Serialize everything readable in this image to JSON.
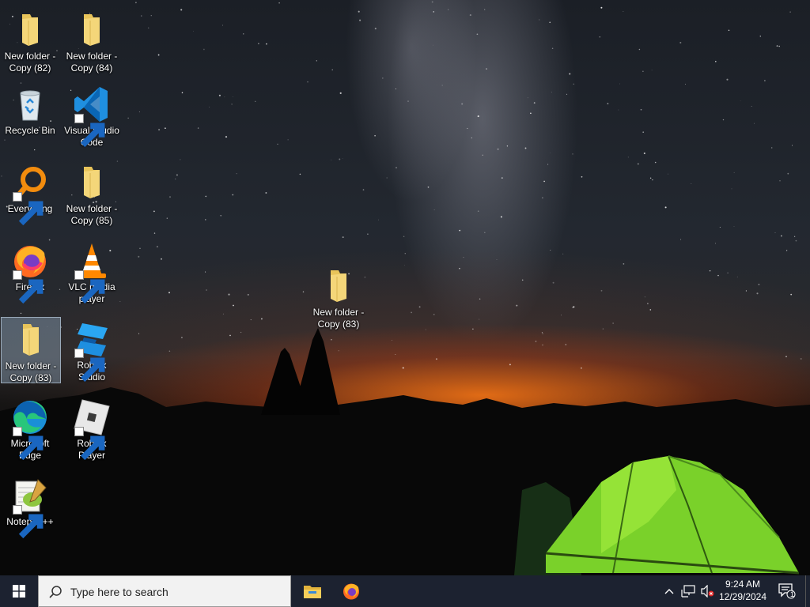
{
  "desktop": {
    "icons": [
      {
        "label": "New folder - Copy (82)",
        "type": "folder"
      },
      {
        "label": "New folder - Copy (84)",
        "type": "folder"
      },
      {
        "label": "Recycle Bin",
        "type": "recycle-bin"
      },
      {
        "label": "Visual Studio Code",
        "type": "vscode",
        "shortcut": true
      },
      {
        "label": "Everything",
        "type": "everything",
        "shortcut": true
      },
      {
        "label": "New folder - Copy (85)",
        "type": "folder"
      },
      {
        "label": "Firefox",
        "type": "firefox",
        "shortcut": true
      },
      {
        "label": "VLC media player",
        "type": "vlc",
        "shortcut": true
      },
      {
        "label": "New folder - Copy (83)",
        "type": "folder",
        "selected": true
      },
      {
        "label": "Roblox Studio",
        "type": "roblox-studio",
        "shortcut": true
      },
      {
        "label": "Microsoft Edge",
        "type": "edge",
        "shortcut": true
      },
      {
        "label": "Roblox Player",
        "type": "roblox-player",
        "shortcut": true
      },
      {
        "label": "Notepad++",
        "type": "notepadpp",
        "shortcut": true
      },
      {
        "label": "New folder - Copy (83)",
        "type": "folder"
      }
    ]
  },
  "taskbar": {
    "search_placeholder": "Type here to search",
    "pinned_apps": [
      "file-explorer-icon",
      "firefox-icon"
    ],
    "tray": {
      "time": "9:24 AM",
      "date": "12/29/2024",
      "notification_count": "1",
      "volume_muted": true
    }
  },
  "colors": {
    "taskbar_bg": "#1c2230",
    "folder_yellow": "#f4d679",
    "selection": "#aac8e6"
  }
}
